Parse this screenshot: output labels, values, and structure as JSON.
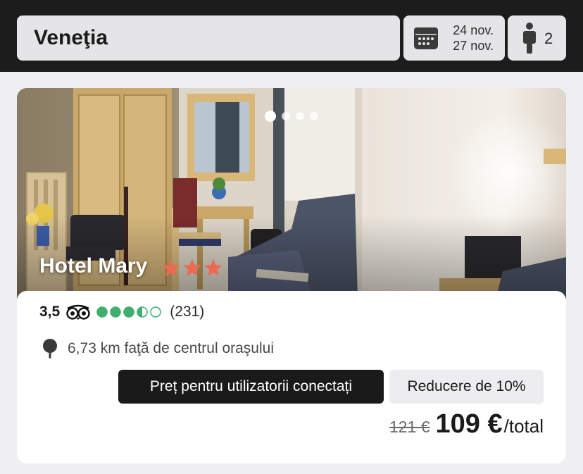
{
  "search": {
    "destination": "Veneţia"
  },
  "dates": {
    "check_in": "24 nov.",
    "check_out": "27 nov.",
    "icon": "calendar-icon"
  },
  "guests": {
    "count": "2",
    "icon": "person-icon"
  },
  "hotel": {
    "name": "Hotel Mary",
    "stars": 3,
    "star_color": "#ec6a52",
    "carousel": {
      "total": 4,
      "active_index": 0
    },
    "rating": {
      "score": "3,5",
      "bubbles_filled": 3.5,
      "bubbles_total": 5,
      "bubble_color": "#3fae6f",
      "reviews": "(231)",
      "icon": "tripadvisor-icon"
    },
    "distance": "6,73 km faţă de centrul oraşului",
    "badges": {
      "member_price": "Preț pentru utilizatorii conectați",
      "discount": "Reducere de 10%"
    },
    "price": {
      "old": "121 €",
      "new": "109 €",
      "suffix": "/total"
    }
  },
  "colors": {
    "topbar": "#1c1c1c",
    "background": "#efeff1",
    "field": "#e5e5e7"
  }
}
